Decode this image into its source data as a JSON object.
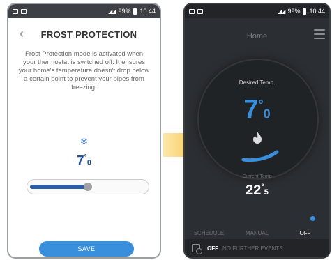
{
  "status_bar": {
    "battery": "99%",
    "time": "10:44"
  },
  "left_screen": {
    "title": "FROST PROTECTION",
    "back_icon": "chevron-left-icon",
    "description": "Frost Protection mode is activated when your thermostat is switched off. It ensures your home's temperature doesn't drop below a certain point to prevent your pipes from freezing.",
    "snow_icon": "snowflake-icon",
    "temperature_main": "7",
    "temperature_unit": "°",
    "temperature_decimal": "0",
    "slider_value_fraction": 0.5,
    "save_label": "SAVE"
  },
  "right_screen": {
    "title": "Home",
    "menu_icon": "hamburger-menu-icon",
    "desired_label": "Desired Temp.",
    "desired_main": "7",
    "desired_unit": "°",
    "desired_decimal": "0",
    "flame_icon": "flame-icon",
    "current_label": "Current Temp",
    "current_main": "22",
    "current_unit": "°",
    "current_decimal": "5",
    "modes": [
      {
        "label": "SCHEDULE",
        "active": false
      },
      {
        "label": "MANUAL",
        "active": false
      },
      {
        "label": "OFF",
        "active": true
      }
    ],
    "footer_status": "OFF",
    "footer_events": "NO FURTHER EVENTS"
  },
  "colors": {
    "accent_blue": "#3a8fdc",
    "slider_blue": "#2d5ea8",
    "arrow_yellow": "#f4b92a",
    "dark_bg": "#2b2e32"
  }
}
